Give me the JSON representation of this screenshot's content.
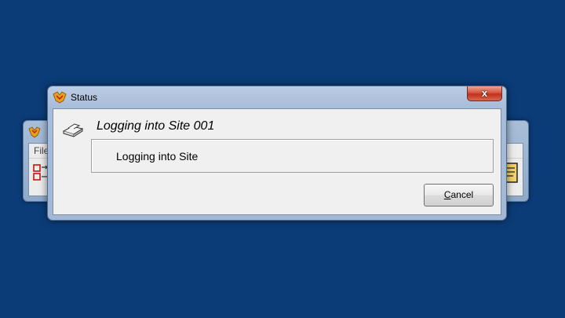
{
  "background_window": {
    "menu_label": "File"
  },
  "dialog": {
    "title": "Status",
    "close_label": "x",
    "heading": "Logging into Site 001",
    "message": "Logging into Site",
    "cancel_accel": "C",
    "cancel_rest": "ancel"
  },
  "icons": {
    "app": "app-logo-icon",
    "printer": "printer-icon",
    "close": "close-icon"
  },
  "colors": {
    "desktop": "#0b3c78",
    "close_button": "#c2301a"
  }
}
